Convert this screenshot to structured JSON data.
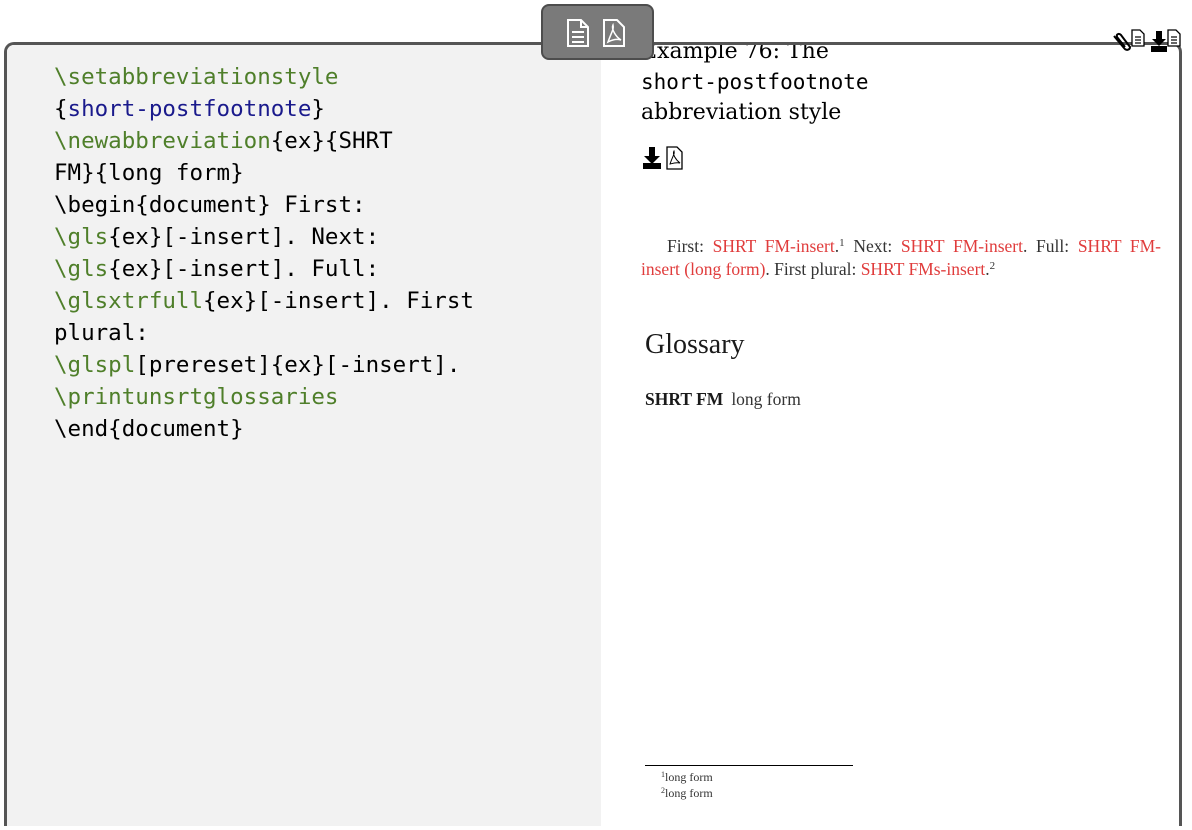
{
  "code_lines": [
    [
      {
        "t": "\\setabbreviationstyle",
        "c": "cmd"
      }
    ],
    [
      {
        "t": "{",
        "c": ""
      },
      {
        "t": "short-postfootnote",
        "c": "arg"
      },
      {
        "t": "}",
        "c": ""
      }
    ],
    [
      {
        "t": "\\newabbreviation",
        "c": "cmd"
      },
      {
        "t": "{ex}{SHRT",
        "c": ""
      }
    ],
    [
      {
        "t": "FM}{long form}",
        "c": ""
      }
    ],
    [
      {
        "t": "\\begin{document} First:",
        "c": ""
      }
    ],
    [
      {
        "t": "\\gls",
        "c": "cmd"
      },
      {
        "t": "{ex}[-insert]. Next:",
        "c": ""
      }
    ],
    [
      {
        "t": "\\gls",
        "c": "cmd"
      },
      {
        "t": "{ex}[-insert]. Full:",
        "c": ""
      }
    ],
    [
      {
        "t": "\\glsxtrfull",
        "c": "cmd"
      },
      {
        "t": "{ex}[-insert]. First",
        "c": ""
      }
    ],
    [
      {
        "t": "plural:",
        "c": ""
      }
    ],
    [
      {
        "t": "\\glspl",
        "c": "cmd"
      },
      {
        "t": "[prereset]{ex}[-insert].",
        "c": ""
      }
    ],
    [
      {
        "t": "\\printunsrtglossaries",
        "c": "cmd"
      }
    ],
    [
      {
        "t": "\\end{document}",
        "c": ""
      }
    ]
  ],
  "example": {
    "title_line1": "Example 76: The",
    "title_line2": "short-postfootnote",
    "title_line3": "abbreviation style"
  },
  "output": {
    "first_label": "First:",
    "first_link": "SHRT FM-insert",
    "first_fn": "1",
    "next_label": "Next:",
    "next_link": "SHRT FM-insert",
    "full_label": "Full:",
    "full_link": "SHRT FM-insert (long form)",
    "plural_label": "First plural:",
    "plural_link": "SHRT FMs-insert",
    "plural_fn": "2",
    "glossary_heading": "Glossary",
    "gloss_term": "SHRT FM",
    "gloss_desc": "long form",
    "footnotes": [
      {
        "num": "1",
        "text": "long form"
      },
      {
        "num": "2",
        "text": "long form"
      }
    ]
  },
  "icons": {
    "tab": [
      "document-icon",
      "pdf-icon"
    ],
    "title": [
      "download-icon",
      "pdf-icon"
    ],
    "corner": [
      "attachment-icon",
      "document-icon",
      "download-icon",
      "document-icon"
    ]
  },
  "colors": {
    "command": "#4f7f2a",
    "argument": "#1a1a8c",
    "link": "#e03c3c",
    "code_background": "#f2f2f2",
    "frame": "#555555"
  }
}
